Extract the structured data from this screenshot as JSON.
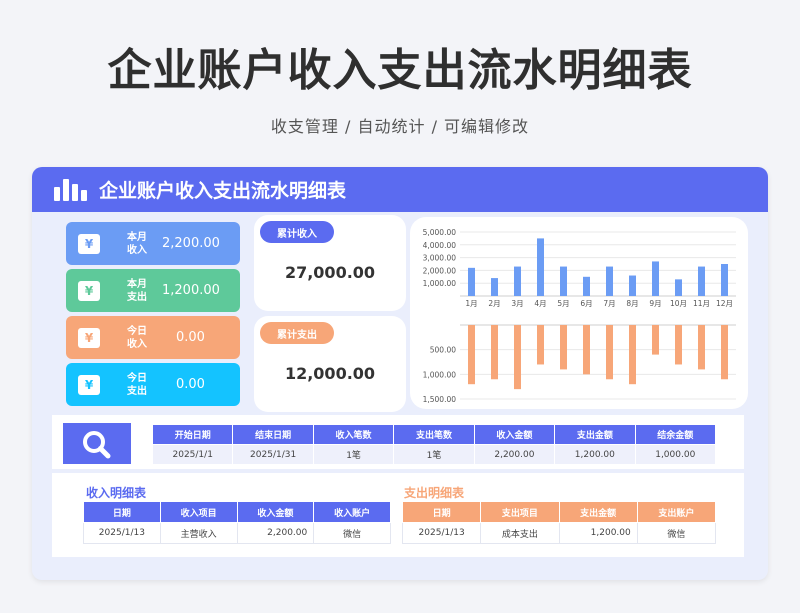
{
  "page": {
    "title": "企业账户收入支出流水明细表",
    "subtitle": "收支管理 / 自动统计 / 可编辑修改"
  },
  "card": {
    "title": "企业账户收入支出流水明细表"
  },
  "colors": {
    "primary": "#5b6bf0",
    "green": "#5ec99a",
    "orange": "#f7a678",
    "cyan": "#14c3ff",
    "blue": "#6b9cf4"
  },
  "stats": [
    {
      "icon": "yen-icon",
      "label": "本月收入",
      "label_line1": "本月",
      "label_line2": "收入",
      "value": "2,200.00",
      "color": "#6b9cf4"
    },
    {
      "icon": "yen-icon",
      "label": "本月支出",
      "label_line1": "本月",
      "label_line2": "支出",
      "value": "1,200.00",
      "color": "#5ec99a"
    },
    {
      "icon": "yen-icon",
      "label": "今日收入",
      "label_line1": "今日",
      "label_line2": "收入",
      "value": "0.00",
      "color": "#f7a678"
    },
    {
      "icon": "yen-icon",
      "label": "今日支出",
      "label_line1": "今日",
      "label_line2": "支出",
      "value": "0.00",
      "color": "#14c3ff"
    }
  ],
  "totals": {
    "income": {
      "label": "累计收入",
      "value": "27,000.00"
    },
    "expense": {
      "label": "累计支出",
      "value": "12,000.00"
    }
  },
  "chart_data": [
    {
      "type": "bar",
      "categories": [
        "1月",
        "2月",
        "3月",
        "4月",
        "5月",
        "6月",
        "7月",
        "8月",
        "9月",
        "10月",
        "11月",
        "12月"
      ],
      "values": [
        2200,
        1400,
        2300,
        4500,
        2300,
        1500,
        2300,
        1600,
        2700,
        1300,
        2300,
        2500
      ],
      "ylim": [
        0,
        5000
      ],
      "yticks": [
        "1,000.00",
        "2,000.00",
        "3,000.00",
        "4,000.00",
        "5,000.00"
      ],
      "ytick_values": [
        1000,
        2000,
        3000,
        4000,
        5000
      ],
      "color": "#6b9cf4",
      "grid": true
    },
    {
      "type": "bar",
      "categories": [
        "1月",
        "2月",
        "3月",
        "4月",
        "5月",
        "6月",
        "7月",
        "8月",
        "9月",
        "10月",
        "11月",
        "12月"
      ],
      "values": [
        1200,
        1100,
        1300,
        800,
        900,
        1000,
        1100,
        1200,
        600,
        800,
        900,
        1100
      ],
      "ylim": [
        0,
        1500
      ],
      "inverted": true,
      "yticks": [
        "500.00",
        "1,000.00",
        "1,500.00"
      ],
      "ytick_values": [
        500,
        1000,
        1500
      ],
      "color": "#f7a678",
      "grid": true
    }
  ],
  "search": {
    "icon": "search-icon"
  },
  "summary": {
    "headers": [
      "开始日期",
      "结束日期",
      "收入笔数",
      "支出笔数",
      "收入金额",
      "支出金额",
      "结余金额"
    ],
    "row": [
      "2025/1/1",
      "2025/1/31",
      "1笔",
      "1笔",
      "2,200.00",
      "1,200.00",
      "1,000.00"
    ]
  },
  "income_detail": {
    "title": "收入明细表",
    "headers": [
      "日期",
      "收入项目",
      "收入金额",
      "收入账户"
    ],
    "rows": [
      [
        "2025/1/13",
        "主营收入",
        "2,200.00",
        "微信"
      ]
    ]
  },
  "expense_detail": {
    "title": "支出明细表",
    "headers": [
      "日期",
      "支出项目",
      "支出金额",
      "支出账户"
    ],
    "rows": [
      [
        "2025/1/13",
        "成本支出",
        "1,200.00",
        "微信"
      ]
    ]
  }
}
